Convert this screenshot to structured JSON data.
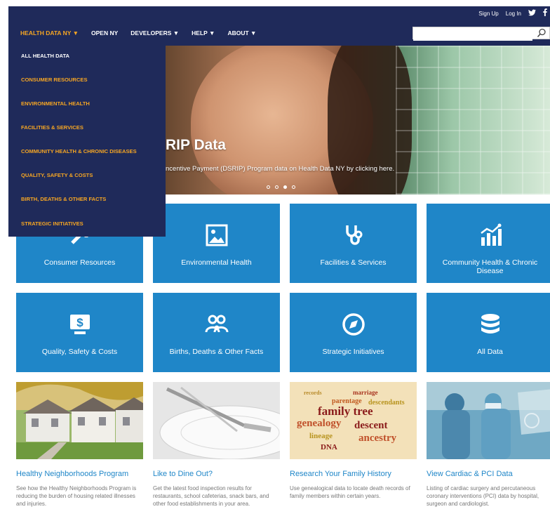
{
  "util": {
    "signup": "Sign Up",
    "login": "Log In"
  },
  "nav": [
    {
      "label": "HEALTH DATA NY ▼",
      "active": true
    },
    {
      "label": "OPEN NY"
    },
    {
      "label": "DEVELOPERS ▼"
    },
    {
      "label": "HELP ▼"
    },
    {
      "label": "ABOUT ▼"
    }
  ],
  "search": {
    "value": "",
    "placeholder": ""
  },
  "dropdown": [
    "ALL HEALTH DATA",
    "CONSUMER RESOURCES",
    "ENVIRONMENTAL HEALTH",
    "FACILITIES & SERVICES",
    "COMMUNITY HEALTH & CHRONIC DISEASES",
    "QUALITY, SAFETY & COSTS",
    "BIRTH, DEATHS & OTHER FACTS",
    "STRATEGIC INITIATIVES"
  ],
  "hero": {
    "title": "RIP Data",
    "subtitle": "ncentive Payment (DSRIP) Program data on Health Data NY by clicking here.",
    "slides": 4,
    "active_slide": 3
  },
  "tiles": [
    {
      "label": "Consumer Resources",
      "icon": "arrow-icon"
    },
    {
      "label": "Environmental Health",
      "icon": "picture-icon"
    },
    {
      "label": "Facilities & Services",
      "icon": "stethoscope-icon"
    },
    {
      "label": "Community Health & Chronic Disease",
      "icon": "chart-icon"
    },
    {
      "label": "Quality, Safety & Costs",
      "icon": "dollar-monitor-icon"
    },
    {
      "label": "Births, Deaths & Other Facts",
      "icon": "people-icon"
    },
    {
      "label": "Strategic Initiatives",
      "icon": "compass-icon"
    },
    {
      "label": "All Data",
      "icon": "database-icon"
    }
  ],
  "cards": [
    {
      "title": "Healthy Neighborhoods Program",
      "desc": "See how the Healthy Neighborhoods Program is reducing the burden of housing related illnesses and injuries.",
      "image": "houses-image"
    },
    {
      "title": "Like to Dine Out?",
      "desc": "Get the latest food inspection results for restaurants, school cafeterias, snack bars, and other food establishments in your area.",
      "image": "fork-plate-image"
    },
    {
      "title": "Research Your Family History",
      "desc": "Use genealogical data to locate death records of family members within certain years.",
      "image": "word-cloud-image",
      "cloud_words": [
        "family tree",
        "genealogy",
        "descent",
        "lineage",
        "DNA",
        "ancestry",
        "parentage",
        "descendants",
        "marriage",
        "records"
      ]
    },
    {
      "title": "View Cardiac & PCI Data",
      "desc": "Listing of cardiac surgery and percutaneous coronary interventions (PCI) data by hospital, surgeon and cardiologist.",
      "image": "surgeons-image"
    }
  ],
  "colors": {
    "navy": "#1f2a5a",
    "orange": "#f6a623",
    "tile_blue": "#1f86c8"
  }
}
